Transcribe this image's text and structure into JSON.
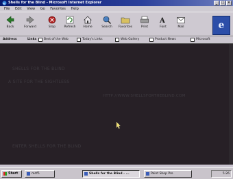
{
  "window": {
    "title": "Shells for the Blind - Microsoft Internet Explorer"
  },
  "window_buttons": [
    "_",
    "□",
    "×"
  ],
  "menu": [
    "File",
    "Edit",
    "View",
    "Go",
    "Favorites",
    "Help"
  ],
  "toolbar": [
    "Back",
    "Forward",
    "Stop",
    "Refresh",
    "Home",
    "Search",
    "Favorites",
    "Print",
    "Font",
    "Mail"
  ],
  "address_label": "Address",
  "links_label": "Links",
  "links": [
    "Best of the Web",
    "Today's Links",
    "Web Gallery",
    "Product News",
    "Microsoft"
  ],
  "content": {
    "line1": "SHELLS FOR THE BLIND",
    "line2": "A SITE FOR THE SIGHTLESS",
    "line3": "HTTP://WWW.SHELLSFORTHEBLIND.COM",
    "line4": "ENTER SHELLS FOR THE BLIND"
  },
  "taskbar": {
    "start": "Start",
    "items": [
      "mdf5",
      "Shells for the Blind - ...",
      "Paint Shop Pro"
    ],
    "clock": "5:26"
  },
  "colors": {
    "content_bg": "#272026",
    "title_bg": "#0a1a6e"
  }
}
